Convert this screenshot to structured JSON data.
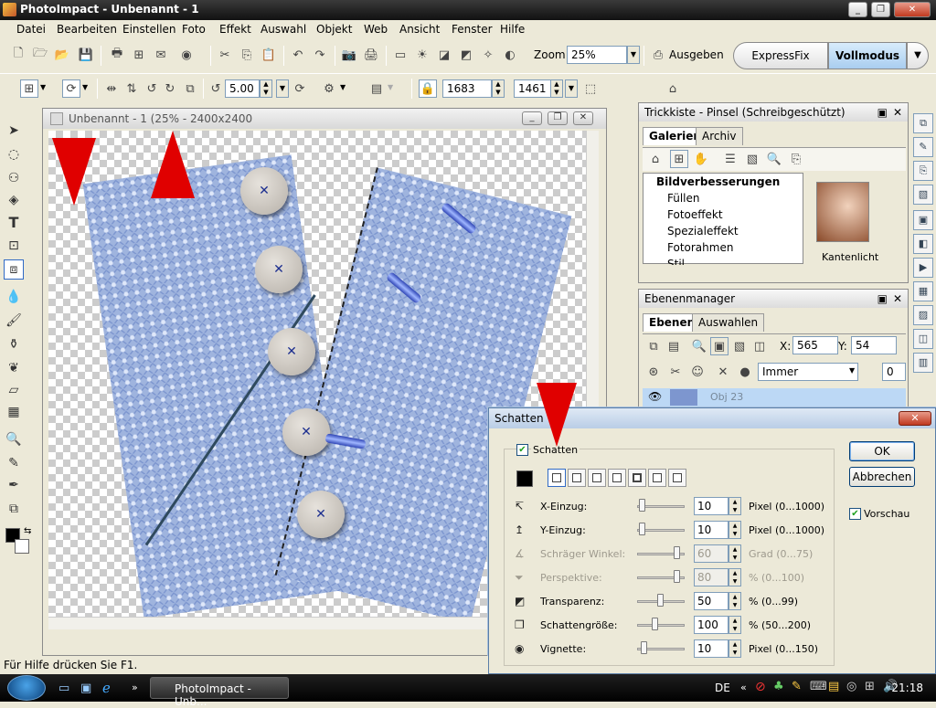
{
  "window": {
    "title": "PhotoImpact - Unbenannt - 1",
    "controls": [
      "_",
      "❐",
      "✕"
    ]
  },
  "menu": [
    "Datei",
    "Bearbeiten",
    "Einstellen",
    "Foto",
    "Effekt",
    "Auswahl",
    "Objekt",
    "Web",
    "Ansicht",
    "Fenster",
    "Hilfe"
  ],
  "toolbar1": {
    "zoom_label": "Zoom",
    "zoom_value": "25%",
    "ausgeben_label": "Ausgeben",
    "expressfix_label": "ExpressFix",
    "vollmodus_label": "Vollmodus"
  },
  "toolbar2": {
    "rotate_value": "5.00",
    "width_value": "1683",
    "height_value": "1461"
  },
  "document": {
    "title": "Unbenannt - 1 (25% - 2400x2400"
  },
  "trickkiste": {
    "title": "Trickkiste - Pinsel (Schreibgeschützt)",
    "tabs": [
      "Galerien",
      "Archiv"
    ],
    "tree": [
      "Bildverbesserungen",
      "Füllen",
      "Fotoeffekt",
      "Spezialeffekt",
      "Fotorahmen",
      "Stil"
    ],
    "thumb_label": "Kantenlicht"
  },
  "ebenen": {
    "title": "Ebenenmanager",
    "tabs": [
      "Ebenen",
      "Auswahlen"
    ],
    "x_label": "X:",
    "x_value": "565",
    "y_label": "Y:",
    "y_value": "54",
    "mode_value": "Immer",
    "opacity_value": "0",
    "layer_name": "Obj 23"
  },
  "dialog": {
    "title": "Schatten",
    "checkbox_label": "Schatten",
    "ok_label": "OK",
    "cancel_label": "Abbrechen",
    "preview_label": "Vorschau",
    "rows": [
      {
        "label": "X-Einzug:",
        "value": "10",
        "unit": "Pixel (0...1000)"
      },
      {
        "label": "Y-Einzug:",
        "value": "10",
        "unit": "Pixel (0...1000)"
      },
      {
        "label": "Schräger Winkel:",
        "value": "60",
        "unit": "Grad (0...75)"
      },
      {
        "label": "Perspektive:",
        "value": "80",
        "unit": "% (0...100)"
      },
      {
        "label": "Transparenz:",
        "value": "50",
        "unit": "% (0...99)"
      },
      {
        "label": "Schattengröße:",
        "value": "100",
        "unit": "% (50...200)"
      },
      {
        "label": "Vignette:",
        "value": "10",
        "unit": "Pixel (0...150)"
      }
    ]
  },
  "status": {
    "text": "Für Hilfe drücken Sie F1."
  },
  "taskbar": {
    "task_label": "PhotoImpact - Unb...",
    "lang": "DE",
    "clock": "21:18"
  },
  "colors": {
    "accent_blue": "#bcd8f5",
    "arrow_red": "#e00000",
    "fabric": "#9fb4de"
  }
}
